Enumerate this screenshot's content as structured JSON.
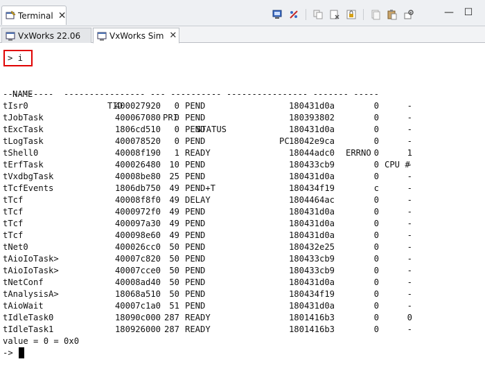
{
  "view_tab": {
    "label": "Terminal",
    "close": "✕"
  },
  "subtabs": [
    {
      "label": "VxWorks 22.06",
      "close": ""
    },
    {
      "label": "VxWorks Sim",
      "close": "✕"
    }
  ],
  "window_controls": {
    "minimize": "—",
    "maximize": "☐"
  },
  "icons": {
    "terminal": "terminal-icon",
    "connect": "connect-icon",
    "disconnect": "disconnect-icon",
    "copy": "copy-icon",
    "clear": "clear-icon",
    "scroll_lock": "scroll-lock-icon",
    "page": "page-icon",
    "paste": "paste-icon",
    "settings": "settings-icon"
  },
  "console": {
    "command": "> i",
    "headers": [
      "NAME",
      "TID",
      "PRI",
      "STATUS",
      "PC",
      "ERRNO",
      "CPU #"
    ],
    "rule": "----------  ---------------- --- ---------- ---------------- ------- -----",
    "rows": [
      [
        "tIsr0",
        "400027920",
        "0",
        "PEND",
        "180431d0a",
        "0",
        "-"
      ],
      [
        "tJobTask",
        "400067080",
        "0",
        "PEND",
        "180393802",
        "0",
        "-"
      ],
      [
        "tExcTask",
        "1806cd510",
        "0",
        "PEND",
        "180431d0a",
        "0",
        "-"
      ],
      [
        "tLogTask",
        "400078520",
        "0",
        "PEND",
        "18042e9ca",
        "0",
        "-"
      ],
      [
        "tShell0",
        "40008f190",
        "1",
        "READY",
        "18044adc0",
        "0",
        "1"
      ],
      [
        "tErfTask",
        "400026480",
        "10",
        "PEND",
        "180433cb9",
        "0",
        "-"
      ],
      [
        "tVxdbgTask",
        "40008be80",
        "25",
        "PEND",
        "180431d0a",
        "0",
        "-"
      ],
      [
        "tTcfEvents",
        "1806db750",
        "49",
        "PEND+T",
        "180434f19",
        "c",
        "-"
      ],
      [
        "tTcf",
        "40008f8f0",
        "49",
        "DELAY",
        "1804464ac",
        "0",
        "-"
      ],
      [
        "tTcf",
        "4000972f0",
        "49",
        "PEND",
        "180431d0a",
        "0",
        "-"
      ],
      [
        "tTcf",
        "400097a30",
        "49",
        "PEND",
        "180431d0a",
        "0",
        "-"
      ],
      [
        "tTcf",
        "400098e60",
        "49",
        "PEND",
        "180431d0a",
        "0",
        "-"
      ],
      [
        "tNet0",
        "400026cc0",
        "50",
        "PEND",
        "180432e25",
        "0",
        "-"
      ],
      [
        "tAioIoTask>",
        "40007c820",
        "50",
        "PEND",
        "180433cb9",
        "0",
        "-"
      ],
      [
        "tAioIoTask>",
        "40007cce0",
        "50",
        "PEND",
        "180433cb9",
        "0",
        "-"
      ],
      [
        "tNetConf",
        "40008ad40",
        "50",
        "PEND",
        "180431d0a",
        "0",
        "-"
      ],
      [
        "tAnalysisA>",
        "18068a510",
        "50",
        "PEND",
        "180434f19",
        "0",
        "-"
      ],
      [
        "tAioWait",
        "40007c1a0",
        "51",
        "PEND",
        "180431d0a",
        "0",
        "-"
      ],
      [
        "tIdleTask0",
        "18090c000",
        "287",
        "READY",
        "1801416b3",
        "0",
        "0"
      ],
      [
        "tIdleTask1",
        "180926000",
        "287",
        "READY",
        "1801416b3",
        "0",
        "-"
      ]
    ],
    "value_line": "value = 0 = 0x0",
    "prompt": "->"
  }
}
